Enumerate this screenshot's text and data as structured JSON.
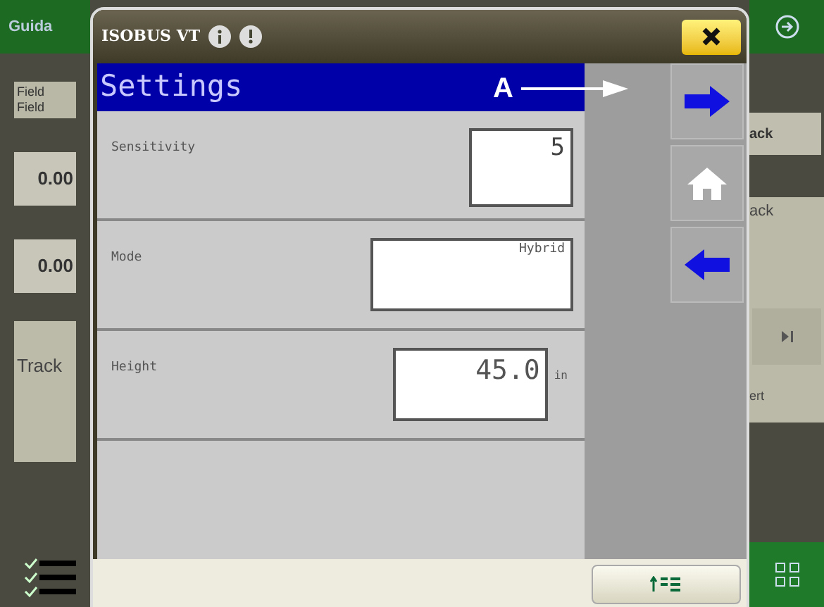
{
  "background": {
    "title": "Guida",
    "fields": [
      "Field",
      "Field"
    ],
    "values": [
      "0.00",
      "0.00"
    ],
    "track": "Track",
    "right_labels": [
      "ack",
      "ack",
      "ert"
    ]
  },
  "dialog": {
    "title": "ISOBUS VT",
    "header": "Settings",
    "rows": [
      {
        "kind": "number",
        "label": "Sensitivity",
        "value": "5"
      },
      {
        "kind": "list",
        "label": "Mode",
        "value": "Hybrid"
      },
      {
        "kind": "measure",
        "label": "Height",
        "value": "45.0",
        "unit": "in"
      }
    ],
    "softkeys": [
      {
        "kind": "next"
      },
      {
        "kind": "home"
      },
      {
        "kind": "back"
      }
    ]
  },
  "annotation": {
    "label": "A"
  }
}
